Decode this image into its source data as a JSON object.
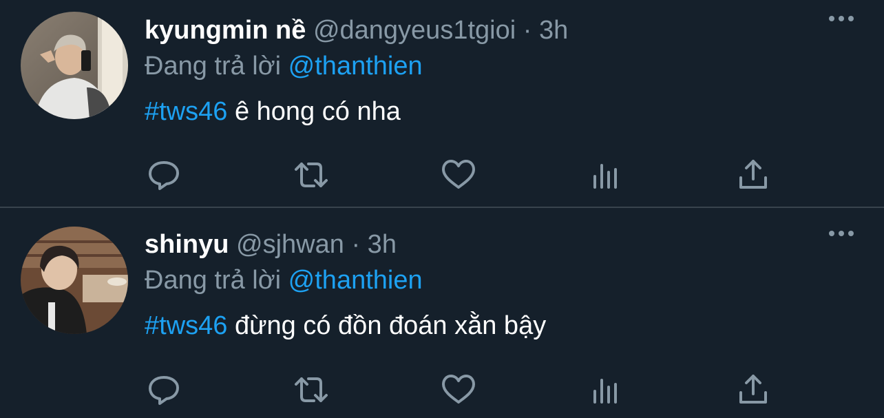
{
  "theme": {
    "background": "#15202b",
    "divider": "#38444d",
    "text_primary": "#ffffff",
    "text_secondary": "#8899a6",
    "accent": "#1da1f2"
  },
  "tweets": [
    {
      "display_name": "kyungmin nề",
      "handle": "@dangyeus1tgioi",
      "time": "· 3h",
      "replying_prefix": "Đang trả lời",
      "replying_to": "@thanthien",
      "hashtag": "#tws46",
      "body": " ê hong có nha",
      "icons": {
        "more": "more-horizontal-icon",
        "reply": "reply-icon",
        "retweet": "retweet-icon",
        "like": "heart-icon",
        "analytics": "analytics-icon",
        "share": "share-icon"
      }
    },
    {
      "display_name": "shinyu",
      "handle": "@sjhwan",
      "time": "· 3h",
      "replying_prefix": "Đang trả lời",
      "replying_to": "@thanthien",
      "hashtag": "#tws46",
      "body": " đừng có đồn đoán xằn bậy",
      "icons": {
        "more": "more-horizontal-icon",
        "reply": "reply-icon",
        "retweet": "retweet-icon",
        "like": "heart-icon",
        "analytics": "analytics-icon",
        "share": "share-icon"
      }
    }
  ]
}
